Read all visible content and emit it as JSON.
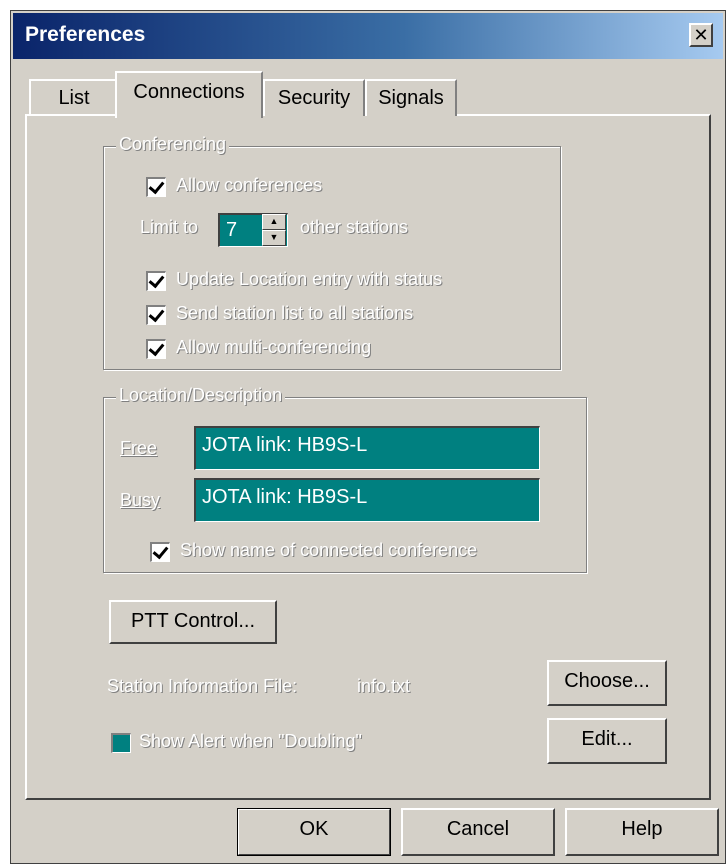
{
  "window": {
    "title": "Preferences",
    "close_glyph": "✕"
  },
  "tabs": [
    {
      "label": "List"
    },
    {
      "label": "Connections"
    },
    {
      "label": "Security"
    },
    {
      "label": "Signals"
    }
  ],
  "conferencing": {
    "legend": "Conferencing",
    "allow_conferences": {
      "label": "Allow conferences",
      "checked": true
    },
    "limit_label_pre": "Limit to",
    "limit_value": "7",
    "limit_label_post": "other stations",
    "update_location": {
      "label": "Update Location entry with status",
      "checked": true
    },
    "send_list": {
      "label": "Send station list to all stations",
      "checked": true
    },
    "allow_multi": {
      "label": "Allow multi-conferencing",
      "checked": true
    }
  },
  "location": {
    "legend": "Location/Description",
    "free_label": "Free",
    "free_value": "JOTA link:  HB9S-L",
    "busy_label": "Busy",
    "busy_value": "JOTA link:  HB9S-L",
    "show_name": {
      "label": "Show name of connected conference",
      "checked": true
    }
  },
  "ptt_button": "PTT Control...",
  "station_info": {
    "label": "Station Information File:",
    "value": "info.txt",
    "choose_button": "Choose..."
  },
  "doubling": {
    "label": "Show Alert when \"Doubling\"",
    "edit_button": "Edit..."
  },
  "footer": {
    "ok": "OK",
    "cancel": "Cancel",
    "help": "Help"
  },
  "colors": {
    "field_bg": "#008080",
    "titlebar_start": "#0a246a",
    "face": "#d4d0c8"
  }
}
